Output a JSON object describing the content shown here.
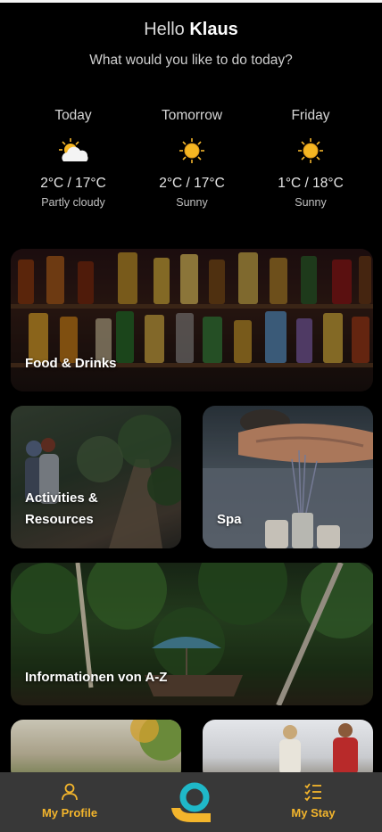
{
  "header": {
    "greeting_prefix": "Hello",
    "user_name": "Klaus",
    "subtitle": "What would you like to do today?"
  },
  "weather": {
    "days": [
      {
        "label": "Today",
        "icon": "partly-cloudy-icon",
        "temp": "2°C / 17°C",
        "condition": "Partly cloudy"
      },
      {
        "label": "Tomorrow",
        "icon": "sun-icon",
        "temp": "2°C / 17°C",
        "condition": "Sunny"
      },
      {
        "label": "Friday",
        "icon": "sun-icon",
        "temp": "1°C / 18°C",
        "condition": "Sunny"
      }
    ]
  },
  "cards": {
    "food": {
      "label": "Food & Drinks"
    },
    "activities": {
      "label_line1": "Activities &",
      "label_line2": "Resources"
    },
    "spa": {
      "label": "Spa"
    },
    "info": {
      "label": "Informationen von A-Z"
    }
  },
  "bottom_nav": {
    "profile_label": "My Profile",
    "stay_label": "My Stay"
  },
  "colors": {
    "accent": "#f3b52c",
    "logo_teal": "#1fb8c8",
    "nav_bg": "#383838",
    "background": "#000000"
  }
}
